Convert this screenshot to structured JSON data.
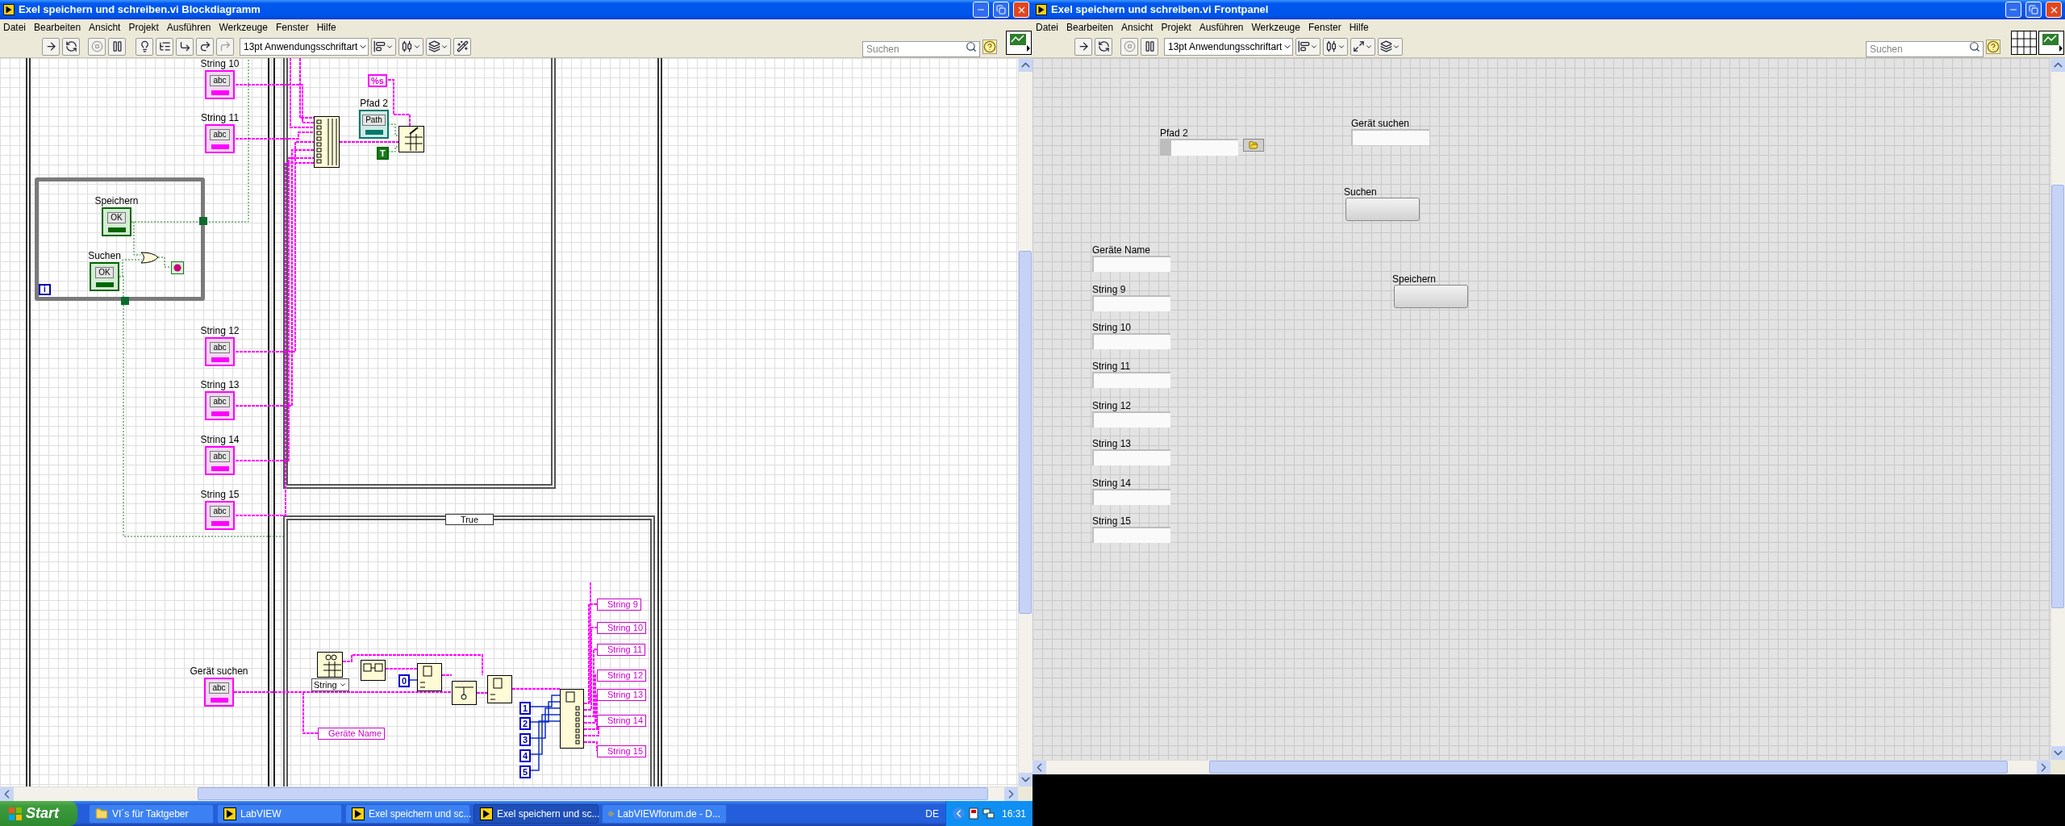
{
  "block_diagram": {
    "title": "Exel speichern und schreiben.vi Blockdiagramm",
    "menu": [
      "Datei",
      "Bearbeiten",
      "Ansicht",
      "Projekt",
      "Ausführen",
      "Werkzeuge",
      "Fenster",
      "Hilfe"
    ],
    "toolbar": {
      "font": "13pt Anwendungsschriftart",
      "search_placeholder": "Suchen"
    },
    "terminals": [
      {
        "label": "String 10",
        "kind": "string",
        "glyph": "abc"
      },
      {
        "label": "String 11",
        "kind": "string",
        "glyph": "abc"
      },
      {
        "label": "Speichern",
        "kind": "boolean",
        "glyph": "OK"
      },
      {
        "label": "Suchen",
        "kind": "boolean",
        "glyph": "OK"
      },
      {
        "label": "String 12",
        "kind": "string",
        "glyph": "abc"
      },
      {
        "label": "String 13",
        "kind": "string",
        "glyph": "abc"
      },
      {
        "label": "String 14",
        "kind": "string",
        "glyph": "abc"
      },
      {
        "label": "String 15",
        "kind": "string",
        "glyph": "abc"
      },
      {
        "label": "Gerät suchen",
        "kind": "string",
        "glyph": "abc"
      },
      {
        "label": "Pfad 2",
        "kind": "path",
        "glyph": "Path"
      }
    ],
    "constants": [
      {
        "text": "%s",
        "kind": "string"
      },
      {
        "text": "T",
        "kind": "boolean"
      },
      {
        "text": "0",
        "kind": "numeric"
      },
      {
        "text": "1",
        "kind": "numeric"
      },
      {
        "text": "2",
        "kind": "numeric"
      },
      {
        "text": "3",
        "kind": "numeric"
      },
      {
        "text": "4",
        "kind": "numeric"
      },
      {
        "text": "5",
        "kind": "numeric"
      }
    ],
    "loop_index": "i",
    "case_selector": "True",
    "type_selector": "String",
    "local_variables": [
      "Geräte Name",
      "String 9",
      "String 10",
      "String 11",
      "String 12",
      "String 13",
      "String 14",
      "String 15"
    ]
  },
  "front_panel": {
    "title": "Exel speichern und schreiben.vi Frontpanel",
    "menu": [
      "Datei",
      "Bearbeiten",
      "Ansicht",
      "Projekt",
      "Ausführen",
      "Werkzeuge",
      "Fenster",
      "Hilfe"
    ],
    "toolbar": {
      "font": "13pt Anwendungsschriftart",
      "search_placeholder": "Suchen"
    },
    "controls": [
      {
        "label": "Gerät suchen",
        "kind": "string"
      },
      {
        "label": "Pfad 2",
        "kind": "path"
      },
      {
        "label": "Suchen",
        "kind": "button"
      },
      {
        "label": "Geräte Name",
        "kind": "string"
      },
      {
        "label": "Speichern",
        "kind": "button"
      },
      {
        "label": "String 9",
        "kind": "string"
      },
      {
        "label": "String 10",
        "kind": "string"
      },
      {
        "label": "String 11",
        "kind": "string"
      },
      {
        "label": "String 12",
        "kind": "string"
      },
      {
        "label": "String 13",
        "kind": "string"
      },
      {
        "label": "String 14",
        "kind": "string"
      },
      {
        "label": "String 15",
        "kind": "string"
      }
    ]
  },
  "taskbar": {
    "start": "Start",
    "items": [
      {
        "label": "VI´s für Taktgeber",
        "kind": "folder",
        "selected": false
      },
      {
        "label": "LabVIEW",
        "kind": "vi",
        "selected": false
      },
      {
        "label": "Exel speichern und sc...",
        "kind": "vi",
        "selected": false
      },
      {
        "label": "Exel speichern und sc...",
        "kind": "vi",
        "selected": true
      },
      {
        "label": "LabVIEWforum.de - D...",
        "kind": "browser",
        "selected": false
      }
    ],
    "language": "DE",
    "time": "16:31"
  }
}
